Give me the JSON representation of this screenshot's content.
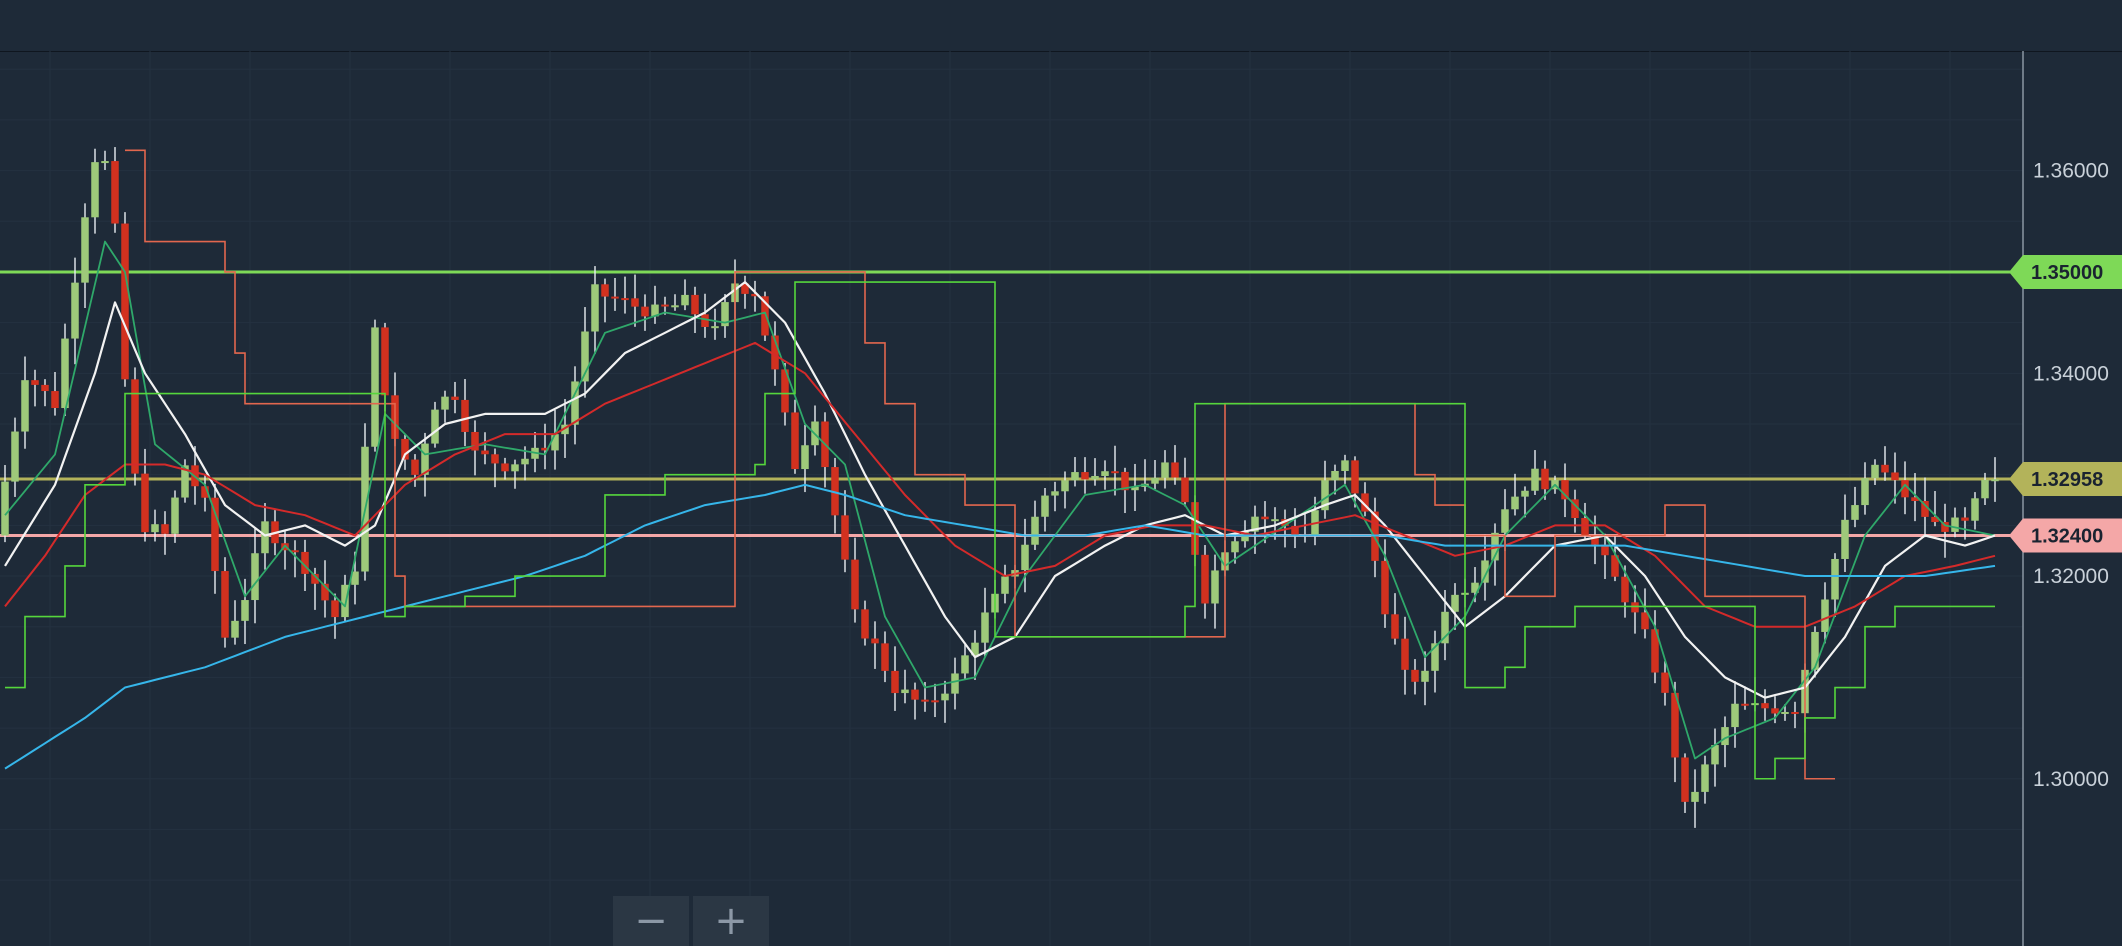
{
  "zoom": {
    "minus_label": "−",
    "plus_label": "+"
  },
  "chart_data": {
    "type": "candlestick",
    "yaxis": {
      "ticks": [
        "1.36000",
        "1.34000",
        "1.32000",
        "1.30000"
      ],
      "ylim": [
        1.2835,
        1.3718
      ],
      "position": "right",
      "grid": true
    },
    "horizontal_lines": [
      {
        "label": "1.35000",
        "value": 1.35,
        "color": "#7ed957"
      },
      {
        "label": "1.32958",
        "value": 1.32958,
        "color": "#b3b35a"
      },
      {
        "label": "1.32400",
        "value": 1.324,
        "color": "#f4a7a7"
      }
    ],
    "price_path": [
      [
        0,
        1.324
      ],
      [
        3,
        1.34
      ],
      [
        6,
        1.337
      ],
      [
        9,
        1.356
      ],
      [
        10.5,
        1.364
      ],
      [
        12,
        1.354
      ],
      [
        13.5,
        1.332
      ],
      [
        15,
        1.325
      ],
      [
        17,
        1.324
      ],
      [
        19,
        1.331
      ],
      [
        21,
        1.327
      ],
      [
        23,
        1.314
      ],
      [
        25,
        1.318
      ],
      [
        27,
        1.325
      ],
      [
        29,
        1.323
      ],
      [
        31,
        1.321
      ],
      [
        34,
        1.316
      ],
      [
        36,
        1.321
      ],
      [
        38,
        1.344
      ],
      [
        40,
        1.333
      ],
      [
        42,
        1.33
      ],
      [
        44,
        1.337
      ],
      [
        46,
        1.338
      ],
      [
        48,
        1.332
      ],
      [
        51,
        1.331
      ],
      [
        54,
        1.332
      ],
      [
        57,
        1.335
      ],
      [
        60,
        1.348
      ],
      [
        63,
        1.347
      ],
      [
        66,
        1.346
      ],
      [
        69,
        1.347
      ],
      [
        72,
        1.344
      ],
      [
        74,
        1.349
      ],
      [
        76,
        1.348
      ],
      [
        78,
        1.34
      ],
      [
        80,
        1.331
      ],
      [
        82,
        1.336
      ],
      [
        84,
        1.326
      ],
      [
        86,
        1.316
      ],
      [
        88,
        1.313
      ],
      [
        90,
        1.309
      ],
      [
        93,
        1.307
      ],
      [
        96,
        1.31
      ],
      [
        99,
        1.316
      ],
      [
        102,
        1.321
      ],
      [
        105,
        1.328
      ],
      [
        108,
        1.33
      ],
      [
        111,
        1.331
      ],
      [
        114,
        1.328
      ],
      [
        117,
        1.331
      ],
      [
        119,
        1.327
      ],
      [
        121,
        1.318
      ],
      [
        123,
        1.323
      ],
      [
        126,
        1.326
      ],
      [
        129,
        1.325
      ],
      [
        131,
        1.324
      ],
      [
        133,
        1.329
      ],
      [
        135,
        1.331
      ],
      [
        137,
        1.326
      ],
      [
        139,
        1.317
      ],
      [
        141,
        1.31
      ],
      [
        143,
        1.31
      ],
      [
        145,
        1.317
      ],
      [
        148,
        1.32
      ],
      [
        151,
        1.327
      ],
      [
        154,
        1.33
      ],
      [
        157,
        1.328
      ],
      [
        160,
        1.323
      ],
      [
        163,
        1.318
      ],
      [
        165,
        1.314
      ],
      [
        167,
        1.308
      ],
      [
        169,
        1.297
      ],
      [
        171,
        1.301
      ],
      [
        174,
        1.307
      ],
      [
        177,
        1.307
      ],
      [
        180,
        1.307
      ],
      [
        182,
        1.315
      ],
      [
        185,
        1.325
      ],
      [
        188,
        1.331
      ],
      [
        191,
        1.328
      ],
      [
        194,
        1.325
      ],
      [
        197,
        1.325
      ],
      [
        199,
        1.329
      ]
    ],
    "indicators": [
      {
        "name": "green_ma",
        "color": "#2fa86a",
        "width": 1.8,
        "path": [
          [
            0,
            1.326
          ],
          [
            5,
            1.332
          ],
          [
            10,
            1.353
          ],
          [
            12,
            1.35
          ],
          [
            15,
            1.333
          ],
          [
            20,
            1.329
          ],
          [
            24,
            1.318
          ],
          [
            28,
            1.323
          ],
          [
            34,
            1.317
          ],
          [
            38,
            1.336
          ],
          [
            42,
            1.332
          ],
          [
            48,
            1.333
          ],
          [
            54,
            1.332
          ],
          [
            60,
            1.344
          ],
          [
            66,
            1.346
          ],
          [
            72,
            1.345
          ],
          [
            76,
            1.346
          ],
          [
            80,
            1.335
          ],
          [
            84,
            1.331
          ],
          [
            88,
            1.316
          ],
          [
            92,
            1.309
          ],
          [
            97,
            1.31
          ],
          [
            102,
            1.32
          ],
          [
            108,
            1.328
          ],
          [
            114,
            1.329
          ],
          [
            118,
            1.327
          ],
          [
            122,
            1.321
          ],
          [
            128,
            1.325
          ],
          [
            134,
            1.329
          ],
          [
            138,
            1.322
          ],
          [
            142,
            1.312
          ],
          [
            146,
            1.316
          ],
          [
            150,
            1.324
          ],
          [
            155,
            1.329
          ],
          [
            160,
            1.324
          ],
          [
            165,
            1.315
          ],
          [
            169,
            1.302
          ],
          [
            172,
            1.304
          ],
          [
            177,
            1.306
          ],
          [
            181,
            1.311
          ],
          [
            186,
            1.324
          ],
          [
            190,
            1.329
          ],
          [
            194,
            1.325
          ],
          [
            199,
            1.324
          ]
        ]
      },
      {
        "name": "white_ma",
        "color": "#f2f2f2",
        "width": 2.2,
        "path": [
          [
            0,
            1.321
          ],
          [
            5,
            1.329
          ],
          [
            9,
            1.34
          ],
          [
            11,
            1.347
          ],
          [
            14,
            1.34
          ],
          [
            18,
            1.334
          ],
          [
            22,
            1.327
          ],
          [
            26,
            1.324
          ],
          [
            30,
            1.325
          ],
          [
            34,
            1.323
          ],
          [
            37,
            1.325
          ],
          [
            40,
            1.332
          ],
          [
            44,
            1.335
          ],
          [
            48,
            1.336
          ],
          [
            54,
            1.336
          ],
          [
            58,
            1.338
          ],
          [
            62,
            1.342
          ],
          [
            66,
            1.344
          ],
          [
            70,
            1.346
          ],
          [
            74,
            1.349
          ],
          [
            78,
            1.345
          ],
          [
            82,
            1.338
          ],
          [
            86,
            1.33
          ],
          [
            90,
            1.323
          ],
          [
            94,
            1.316
          ],
          [
            97,
            1.312
          ],
          [
            101,
            1.314
          ],
          [
            105,
            1.32
          ],
          [
            110,
            1.323
          ],
          [
            114,
            1.325
          ],
          [
            118,
            1.326
          ],
          [
            122,
            1.324
          ],
          [
            127,
            1.325
          ],
          [
            132,
            1.327
          ],
          [
            135,
            1.328
          ],
          [
            138,
            1.325
          ],
          [
            142,
            1.32
          ],
          [
            146,
            1.315
          ],
          [
            150,
            1.318
          ],
          [
            155,
            1.323
          ],
          [
            160,
            1.324
          ],
          [
            164,
            1.32
          ],
          [
            168,
            1.314
          ],
          [
            172,
            1.31
          ],
          [
            176,
            1.308
          ],
          [
            180,
            1.309
          ],
          [
            184,
            1.314
          ],
          [
            188,
            1.321
          ],
          [
            192,
            1.324
          ],
          [
            196,
            1.323
          ],
          [
            199,
            1.324
          ]
        ]
      },
      {
        "name": "red_ma",
        "color": "#d42a2a",
        "width": 2,
        "path": [
          [
            0,
            1.317
          ],
          [
            4,
            1.322
          ],
          [
            8,
            1.328
          ],
          [
            12,
            1.331
          ],
          [
            16,
            1.331
          ],
          [
            20,
            1.33
          ],
          [
            25,
            1.327
          ],
          [
            30,
            1.326
          ],
          [
            35,
            1.324
          ],
          [
            40,
            1.329
          ],
          [
            45,
            1.332
          ],
          [
            50,
            1.334
          ],
          [
            55,
            1.334
          ],
          [
            60,
            1.337
          ],
          [
            65,
            1.339
          ],
          [
            70,
            1.341
          ],
          [
            75,
            1.343
          ],
          [
            80,
            1.34
          ],
          [
            85,
            1.334
          ],
          [
            90,
            1.328
          ],
          [
            95,
            1.323
          ],
          [
            100,
            1.32
          ],
          [
            105,
            1.321
          ],
          [
            110,
            1.324
          ],
          [
            115,
            1.325
          ],
          [
            120,
            1.325
          ],
          [
            125,
            1.324
          ],
          [
            130,
            1.325
          ],
          [
            135,
            1.326
          ],
          [
            140,
            1.324
          ],
          [
            145,
            1.322
          ],
          [
            150,
            1.323
          ],
          [
            155,
            1.325
          ],
          [
            160,
            1.325
          ],
          [
            165,
            1.322
          ],
          [
            170,
            1.317
          ],
          [
            175,
            1.315
          ],
          [
            180,
            1.315
          ],
          [
            185,
            1.317
          ],
          [
            190,
            1.32
          ],
          [
            195,
            1.321
          ],
          [
            199,
            1.322
          ]
        ]
      },
      {
        "name": "blue_ma",
        "color": "#36b6ea",
        "width": 2,
        "path": [
          [
            0,
            1.301
          ],
          [
            8,
            1.306
          ],
          [
            12,
            1.309
          ],
          [
            20,
            1.311
          ],
          [
            28,
            1.314
          ],
          [
            36,
            1.316
          ],
          [
            44,
            1.318
          ],
          [
            52,
            1.32
          ],
          [
            58,
            1.322
          ],
          [
            64,
            1.325
          ],
          [
            70,
            1.327
          ],
          [
            76,
            1.328
          ],
          [
            80,
            1.329
          ],
          [
            84,
            1.328
          ],
          [
            90,
            1.326
          ],
          [
            96,
            1.325
          ],
          [
            102,
            1.324
          ],
          [
            108,
            1.324
          ],
          [
            114,
            1.325
          ],
          [
            120,
            1.324
          ],
          [
            126,
            1.324
          ],
          [
            132,
            1.324
          ],
          [
            138,
            1.324
          ],
          [
            144,
            1.323
          ],
          [
            150,
            1.323
          ],
          [
            156,
            1.323
          ],
          [
            162,
            1.323
          ],
          [
            168,
            1.322
          ],
          [
            174,
            1.321
          ],
          [
            180,
            1.32
          ],
          [
            186,
            1.32
          ],
          [
            192,
            1.32
          ],
          [
            199,
            1.321
          ]
        ]
      }
    ],
    "step_lines": [
      {
        "name": "upper_channel",
        "color": "#e2674e",
        "width": 1.6,
        "steps": [
          [
            12,
            1.362
          ],
          [
            14,
            1.353
          ],
          [
            22,
            1.35
          ],
          [
            23,
            1.342
          ],
          [
            24,
            1.337
          ],
          [
            37,
            1.337
          ],
          [
            39,
            1.32
          ],
          [
            40,
            1.317
          ],
          [
            73,
            1.35
          ],
          [
            82,
            1.35
          ],
          [
            86,
            1.343
          ],
          [
            88,
            1.337
          ],
          [
            91,
            1.33
          ],
          [
            96,
            1.327
          ],
          [
            101,
            1.314
          ],
          [
            122,
            1.337
          ],
          [
            139,
            1.337
          ],
          [
            141,
            1.33
          ],
          [
            143,
            1.327
          ],
          [
            146,
            1.324
          ],
          [
            150,
            1.318
          ],
          [
            155,
            1.324
          ],
          [
            166,
            1.327
          ],
          [
            170,
            1.318
          ],
          [
            180,
            1.3
          ],
          [
            183,
            1.3
          ]
        ]
      },
      {
        "name": "lower_channel",
        "color": "#56d63c",
        "width": 1.6,
        "steps": [
          [
            0,
            1.309
          ],
          [
            2,
            1.316
          ],
          [
            6,
            1.321
          ],
          [
            8,
            1.329
          ],
          [
            12,
            1.338
          ],
          [
            13,
            1.338
          ],
          [
            38,
            1.316
          ],
          [
            40,
            1.317
          ],
          [
            46,
            1.318
          ],
          [
            51,
            1.32
          ],
          [
            57,
            1.32
          ],
          [
            60,
            1.328
          ],
          [
            66,
            1.33
          ],
          [
            72,
            1.33
          ],
          [
            75,
            1.331
          ],
          [
            76,
            1.338
          ],
          [
            79,
            1.349
          ],
          [
            80,
            1.349
          ],
          [
            99,
            1.314
          ],
          [
            114,
            1.314
          ],
          [
            118,
            1.317
          ],
          [
            119,
            1.337
          ],
          [
            125,
            1.337
          ],
          [
            137,
            1.337
          ],
          [
            146,
            1.309
          ],
          [
            150,
            1.311
          ],
          [
            152,
            1.315
          ],
          [
            157,
            1.317
          ],
          [
            163,
            1.317
          ],
          [
            175,
            1.3
          ],
          [
            177,
            1.302
          ],
          [
            180,
            1.306
          ],
          [
            183,
            1.309
          ],
          [
            186,
            1.315
          ],
          [
            189,
            1.317
          ],
          [
            199,
            1.317
          ]
        ]
      }
    ]
  }
}
